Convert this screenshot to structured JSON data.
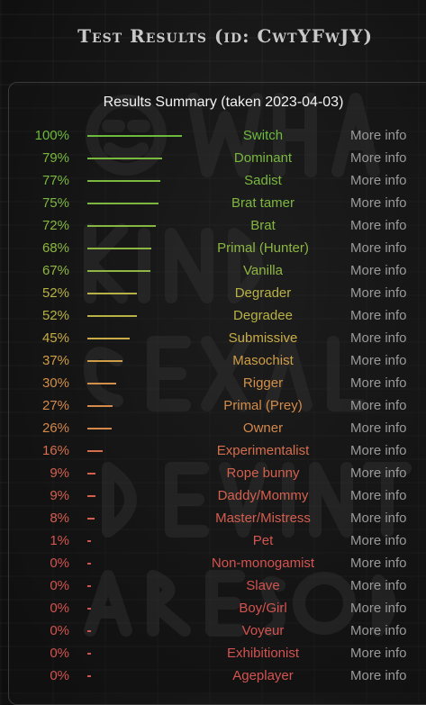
{
  "page_title": "Test Results (id: CwtYFwJY)",
  "summary_title": "Results Summary (taken 2023-04-03)",
  "more_info_label": "More info",
  "results": [
    {
      "pct": "100%",
      "value": 100,
      "label": "Switch",
      "color": "#6dbb3c"
    },
    {
      "pct": "79%",
      "value": 79,
      "label": "Dominant",
      "color": "#78b83d"
    },
    {
      "pct": "77%",
      "value": 77,
      "label": "Sadist",
      "color": "#7ab83e"
    },
    {
      "pct": "75%",
      "value": 75,
      "label": "Brat tamer",
      "color": "#7db73f"
    },
    {
      "pct": "72%",
      "value": 72,
      "label": "Brat",
      "color": "#84b740"
    },
    {
      "pct": "68%",
      "value": 68,
      "label": "Primal (Hunter)",
      "color": "#8cb641"
    },
    {
      "pct": "67%",
      "value": 67,
      "label": "Vanilla",
      "color": "#8fb642"
    },
    {
      "pct": "52%",
      "value": 52,
      "label": "Degrader",
      "color": "#b8b244"
    },
    {
      "pct": "52%",
      "value": 52,
      "label": "Degradee",
      "color": "#b8b244"
    },
    {
      "pct": "45%",
      "value": 45,
      "label": "Submissive",
      "color": "#c9ac45"
    },
    {
      "pct": "37%",
      "value": 37,
      "label": "Masochist",
      "color": "#d09e46"
    },
    {
      "pct": "30%",
      "value": 30,
      "label": "Rigger",
      "color": "#d48f48"
    },
    {
      "pct": "27%",
      "value": 27,
      "label": "Primal (Prey)",
      "color": "#d48a49"
    },
    {
      "pct": "26%",
      "value": 26,
      "label": "Owner",
      "color": "#d4884a"
    },
    {
      "pct": "16%",
      "value": 16,
      "label": "Experimentalist",
      "color": "#d46e4c"
    },
    {
      "pct": "9%",
      "value": 9,
      "label": "Rope bunny",
      "color": "#d4604e"
    },
    {
      "pct": "9%",
      "value": 9,
      "label": "Daddy/Mommy",
      "color": "#d4604e"
    },
    {
      "pct": "8%",
      "value": 8,
      "label": "Master/Mistress",
      "color": "#d45e4f"
    },
    {
      "pct": "1%",
      "value": 1,
      "label": "Pet",
      "color": "#d45550"
    },
    {
      "pct": "0%",
      "value": 0,
      "label": "Non-monogamist",
      "color": "#d45350"
    },
    {
      "pct": "0%",
      "value": 0,
      "label": "Slave",
      "color": "#d45350"
    },
    {
      "pct": "0%",
      "value": 0,
      "label": "Boy/Girl",
      "color": "#d45350"
    },
    {
      "pct": "0%",
      "value": 0,
      "label": "Voyeur",
      "color": "#d45350"
    },
    {
      "pct": "0%",
      "value": 0,
      "label": "Exhibitionist",
      "color": "#d45350"
    },
    {
      "pct": "0%",
      "value": 0,
      "label": "Ageplayer",
      "color": "#d45350"
    }
  ]
}
